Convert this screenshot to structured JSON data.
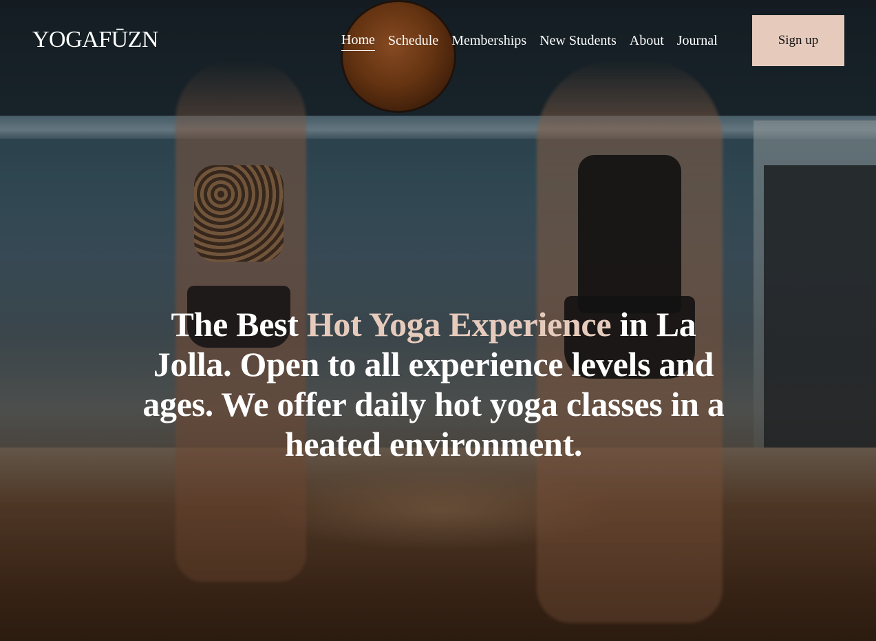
{
  "brand": {
    "logo_text": "YOGAFŪZN"
  },
  "nav": {
    "items": [
      {
        "label": "Home",
        "active": true
      },
      {
        "label": "Schedule",
        "active": false
      },
      {
        "label": "Memberships",
        "active": false
      },
      {
        "label": "New Students",
        "active": false
      },
      {
        "label": "About",
        "active": false
      },
      {
        "label": "Journal",
        "active": false
      }
    ]
  },
  "header": {
    "signup_label": "Sign up"
  },
  "hero": {
    "text_prefix": "The Best ",
    "text_accent": "Hot Yoga Experience",
    "text_suffix": " in La Jolla. Open to all experience levels and ages. We offer daily hot yoga classes in a heated environment."
  },
  "colors": {
    "accent": "#e6cbbd",
    "text": "#ffffff",
    "button_text": "#111111"
  }
}
